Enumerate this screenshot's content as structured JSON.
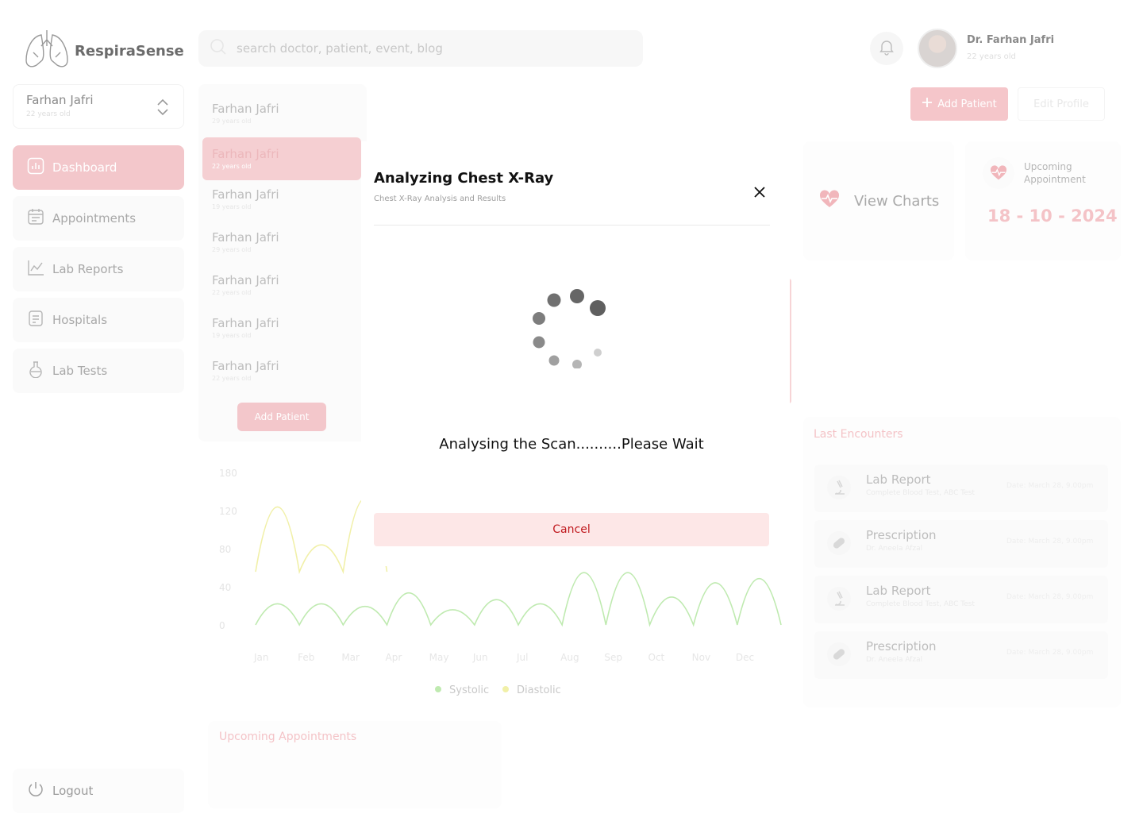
{
  "app": {
    "brand": "RespiraSense"
  },
  "search": {
    "placeholder": "search doctor, patient, event, blog"
  },
  "user": {
    "name": "Dr. Farhan Jafri",
    "age": "22 years old"
  },
  "patient_selector": {
    "name": "Farhan Jafri",
    "age": "22 years old"
  },
  "sidebar": {
    "items": [
      {
        "label": "Dashboard",
        "icon": "bar-chart-icon",
        "active": true
      },
      {
        "label": "Appointments",
        "icon": "calendar-icon"
      },
      {
        "label": "Lab Reports",
        "icon": "line-chart-icon"
      },
      {
        "label": "Hospitals",
        "icon": "document-icon"
      },
      {
        "label": "Lab Tests",
        "icon": "flask-icon"
      }
    ],
    "logout": "Logout"
  },
  "patient_list": {
    "items": [
      {
        "name": "Farhan Jafri",
        "age": "29 years old"
      },
      {
        "name": "Farhan Jafri",
        "age": "22 years old"
      },
      {
        "name": "Farhan Jafri",
        "age": "19 years old"
      },
      {
        "name": "Farhan Jafri",
        "age": "29 years old"
      },
      {
        "name": "Farhan Jafri",
        "age": "22 years old"
      },
      {
        "name": "Farhan Jafri",
        "age": "19 years old"
      },
      {
        "name": "Farhan Jafri",
        "age": "22 years old"
      }
    ],
    "add_label": "Add Patient"
  },
  "header_actions": {
    "add_patient": "Add Patient",
    "edit_profile": "Edit Profile"
  },
  "cards": {
    "view_charts": "View Charts",
    "upcoming_label": "Upcoming Appointment",
    "upcoming_date": "18 - 10 - 2024"
  },
  "encounters": {
    "title": "Last Encounters",
    "items": [
      {
        "name": "Lab Report",
        "sub": "Complete Blood Test, ABC Test",
        "date": "Date: March 28, 9.00pm",
        "icon": "microscope-icon"
      },
      {
        "name": "Prescription",
        "sub": "Dr. Aneela Afzal",
        "date": "Date: March 28, 9.00pm",
        "icon": "pill-icon"
      },
      {
        "name": "Lab Report",
        "sub": "Complete Blood Test, ABC Test",
        "date": "Date: March 28, 9.00pm",
        "icon": "microscope-icon"
      },
      {
        "name": "Prescription",
        "sub": "Dr. Aneela Afzal",
        "date": "Date: March 28, 9.00pm",
        "icon": "pill-icon"
      }
    ]
  },
  "upcoming_appointments": {
    "title": "Upcoming Appointments"
  },
  "chart_data": {
    "type": "line",
    "categories": [
      "Jan",
      "Feb",
      "Mar",
      "Apr",
      "May",
      "Jun",
      "Jul",
      "Aug",
      "Sep",
      "Oct",
      "Nov",
      "Dec"
    ],
    "yticks": [
      180,
      120,
      80,
      40,
      0
    ],
    "ylim": [
      0,
      180
    ],
    "series": [
      {
        "name": "Systolic",
        "color": "#bfeab0",
        "values": [
          25,
          25,
          22,
          38,
          18,
          30,
          25,
          62,
          62,
          33,
          50,
          55
        ]
      },
      {
        "name": "Diastolic",
        "color": "#f1f0a8",
        "values": [
          140,
          95,
          150
        ]
      }
    ],
    "legend": "bottom"
  },
  "modal": {
    "title": "Analyzing Chest X-Ray",
    "subtitle": "Chest X-Ray Analysis and Results",
    "status": "Analysing the Scan..........Please Wait",
    "cancel": "Cancel"
  },
  "colors": {
    "accent": "#f3c7cb",
    "cancel_text": "#c0181d",
    "cancel_bg": "#fde7e7"
  }
}
